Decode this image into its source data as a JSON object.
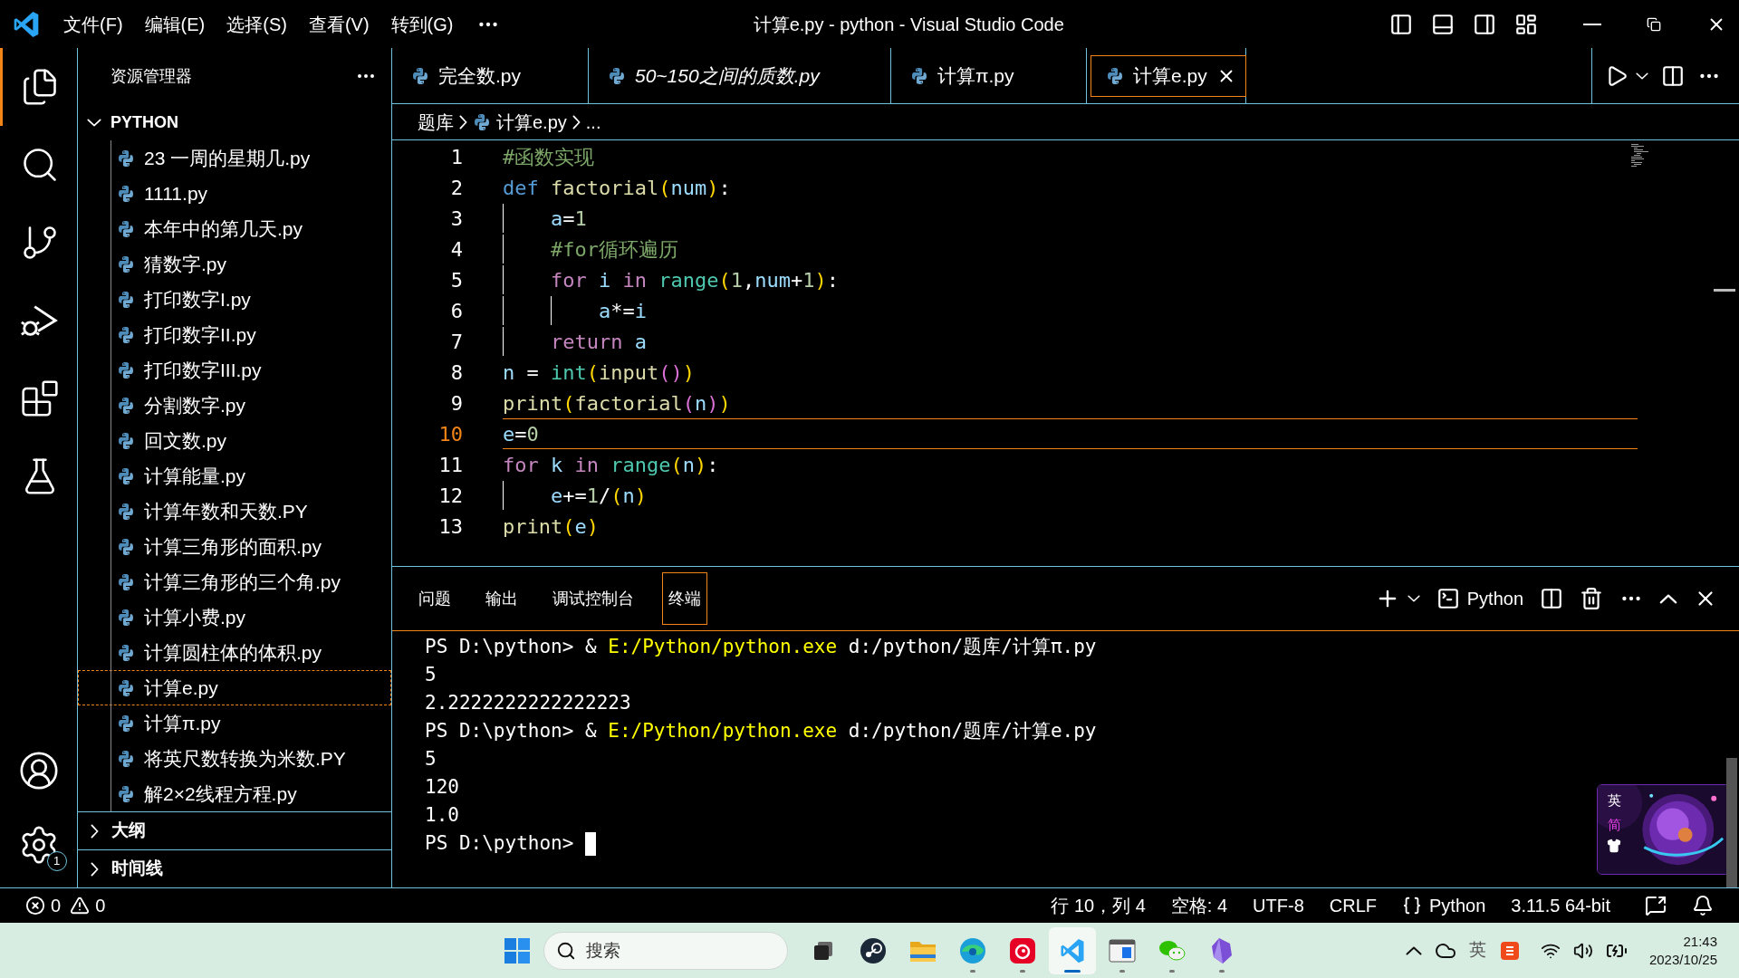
{
  "title_bar": {
    "menus": [
      "文件(F)",
      "编辑(E)",
      "选择(S)",
      "查看(V)",
      "转到(G)"
    ],
    "title": "计算e.py - python - Visual Studio Code"
  },
  "activity_bar": {
    "items": [
      {
        "kind": "explorer",
        "selected": true
      },
      {
        "kind": "search",
        "selected": false
      },
      {
        "kind": "source-control",
        "selected": false
      },
      {
        "kind": "run-debug",
        "selected": false
      },
      {
        "kind": "extensions",
        "selected": false
      },
      {
        "kind": "testing",
        "selected": false
      }
    ],
    "settings_badge": "1"
  },
  "sidebar": {
    "title": "资源管理器",
    "folder": {
      "label": "PYTHON",
      "expanded": true,
      "files": [
        {
          "label": "23 一周的星期几.py",
          "selected": false
        },
        {
          "label": "1111.py",
          "selected": false
        },
        {
          "label": "本年中的第几天.py",
          "selected": false
        },
        {
          "label": "猜数字.py",
          "selected": false
        },
        {
          "label": "打印数字I.py",
          "selected": false
        },
        {
          "label": "打印数字II.py",
          "selected": false
        },
        {
          "label": "打印数字III.py",
          "selected": false
        },
        {
          "label": "分割数字.py",
          "selected": false
        },
        {
          "label": "回文数.py",
          "selected": false
        },
        {
          "label": "计算能量.py",
          "selected": false
        },
        {
          "label": "计算年数和天数.PY",
          "selected": false
        },
        {
          "label": "计算三角形的面积.py",
          "selected": false
        },
        {
          "label": "计算三角形的三个角.py",
          "selected": false
        },
        {
          "label": "计算小费.py",
          "selected": false
        },
        {
          "label": "计算圆柱体的体积.py",
          "selected": false
        },
        {
          "label": "计算e.py",
          "selected": true
        },
        {
          "label": "计算π.py",
          "selected": false
        },
        {
          "label": "将英尺数转换为米数.PY",
          "selected": false
        },
        {
          "label": "解2×2线程方程.py",
          "selected": false
        }
      ]
    },
    "sections": [
      {
        "label": "大纲",
        "expanded": false
      },
      {
        "label": "时间线",
        "expanded": false
      }
    ]
  },
  "tabs": [
    {
      "label": "完全数.py",
      "selected": false,
      "preview": false
    },
    {
      "label": "50~150之间的质数.py",
      "selected": false,
      "preview": true
    },
    {
      "label": "计算π.py",
      "selected": false,
      "preview": false
    },
    {
      "label": "计算e.py",
      "selected": true,
      "preview": false
    }
  ],
  "breadcrumb": [
    "题库",
    "计算e.py",
    "..."
  ],
  "editor": {
    "lines": [
      {
        "number": "1",
        "current": false,
        "tokens": [
          {
            "kind": "comment",
            "text": "#函数实现"
          }
        ]
      },
      {
        "number": "2",
        "current": false,
        "tokens": [
          {
            "kind": "keyword",
            "text": "def"
          },
          {
            "kind": "function",
            "text": " factorial"
          },
          {
            "kind": "bracket1",
            "text": "("
          },
          {
            "kind": "variable",
            "text": "num"
          },
          {
            "kind": "bracket1",
            "text": ")"
          },
          {
            "kind": "plain",
            "text": ":"
          }
        ]
      },
      {
        "number": "3",
        "current": false,
        "tokens": [
          {
            "kind": "guide"
          },
          {
            "kind": "variable",
            "text": "a"
          },
          {
            "kind": "plain",
            "text": "="
          },
          {
            "kind": "number",
            "text": "1"
          }
        ]
      },
      {
        "number": "4",
        "current": false,
        "tokens": [
          {
            "kind": "guide"
          },
          {
            "kind": "comment",
            "text": "#for循环遍历"
          }
        ]
      },
      {
        "number": "5",
        "current": false,
        "tokens": [
          {
            "kind": "guide"
          },
          {
            "kind": "control",
            "text": "for"
          },
          {
            "kind": "variable",
            "text": " i"
          },
          {
            "kind": "control",
            "text": " in"
          },
          {
            "kind": "builtin",
            "text": " range"
          },
          {
            "kind": "bracket1",
            "text": "("
          },
          {
            "kind": "number",
            "text": "1"
          },
          {
            "kind": "plain",
            "text": ","
          },
          {
            "kind": "variable",
            "text": "num"
          },
          {
            "kind": "plain",
            "text": "+"
          },
          {
            "kind": "number",
            "text": "1"
          },
          {
            "kind": "bracket1",
            "text": ")"
          },
          {
            "kind": "plain",
            "text": ":"
          }
        ]
      },
      {
        "number": "6",
        "current": false,
        "tokens": [
          {
            "kind": "guide"
          },
          {
            "kind": "guide"
          },
          {
            "kind": "variable",
            "text": "a"
          },
          {
            "kind": "plain",
            "text": "*="
          },
          {
            "kind": "variable",
            "text": "i"
          }
        ]
      },
      {
        "number": "7",
        "current": false,
        "tokens": [
          {
            "kind": "guide"
          },
          {
            "kind": "control",
            "text": "return"
          },
          {
            "kind": "variable",
            "text": " a"
          }
        ]
      },
      {
        "number": "8",
        "current": false,
        "tokens": [
          {
            "kind": "variable",
            "text": "n"
          },
          {
            "kind": "plain",
            "text": " = "
          },
          {
            "kind": "builtin",
            "text": "int"
          },
          {
            "kind": "bracket1",
            "text": "("
          },
          {
            "kind": "function",
            "text": "input"
          },
          {
            "kind": "bracket2",
            "text": "()"
          },
          {
            "kind": "bracket1",
            "text": ")"
          }
        ]
      },
      {
        "number": "9",
        "current": false,
        "tokens": [
          {
            "kind": "function",
            "text": "print"
          },
          {
            "kind": "bracket1",
            "text": "("
          },
          {
            "kind": "function",
            "text": "factorial"
          },
          {
            "kind": "bracket2",
            "text": "("
          },
          {
            "kind": "variable",
            "text": "n"
          },
          {
            "kind": "bracket2",
            "text": ")"
          },
          {
            "kind": "bracket1",
            "text": ")"
          }
        ]
      },
      {
        "number": "10",
        "current": true,
        "tokens": [
          {
            "kind": "variable",
            "text": "e"
          },
          {
            "kind": "plain",
            "text": "="
          },
          {
            "kind": "number",
            "text": "0"
          }
        ]
      },
      {
        "number": "11",
        "current": false,
        "tokens": [
          {
            "kind": "control",
            "text": "for"
          },
          {
            "kind": "variable",
            "text": " k"
          },
          {
            "kind": "control",
            "text": " in"
          },
          {
            "kind": "builtin",
            "text": " range"
          },
          {
            "kind": "bracket1",
            "text": "("
          },
          {
            "kind": "variable",
            "text": "n"
          },
          {
            "kind": "bracket1",
            "text": ")"
          },
          {
            "kind": "plain",
            "text": ":"
          }
        ]
      },
      {
        "number": "12",
        "current": false,
        "tokens": [
          {
            "kind": "guide"
          },
          {
            "kind": "variable",
            "text": "e"
          },
          {
            "kind": "plain",
            "text": "+="
          },
          {
            "kind": "number",
            "text": "1"
          },
          {
            "kind": "plain",
            "text": "/"
          },
          {
            "kind": "bracket1",
            "text": "("
          },
          {
            "kind": "variable",
            "text": "n"
          },
          {
            "kind": "bracket1",
            "text": ")"
          }
        ]
      },
      {
        "number": "13",
        "current": false,
        "tokens": [
          {
            "kind": "function",
            "text": "print"
          },
          {
            "kind": "bracket1",
            "text": "("
          },
          {
            "kind": "variable",
            "text": "e"
          },
          {
            "kind": "bracket1",
            "text": ")"
          }
        ]
      }
    ]
  },
  "panel": {
    "tabs": [
      {
        "label": "问题",
        "selected": false
      },
      {
        "label": "输出",
        "selected": false
      },
      {
        "label": "调试控制台",
        "selected": false
      },
      {
        "label": "终端",
        "selected": true
      }
    ],
    "terminal_profile": "Python",
    "terminal_lines": [
      {
        "cursor": false,
        "parts": [
          {
            "kind": "plain",
            "text": "PS D:\\python> & "
          },
          {
            "kind": "path",
            "text": "E:/Python/python.exe"
          },
          {
            "kind": "plain",
            "text": " d:/python/题库/计算π.py"
          }
        ]
      },
      {
        "cursor": false,
        "parts": [
          {
            "kind": "plain",
            "text": "5"
          }
        ]
      },
      {
        "cursor": false,
        "parts": [
          {
            "kind": "plain",
            "text": "2.2222222222222223"
          }
        ]
      },
      {
        "cursor": false,
        "parts": [
          {
            "kind": "plain",
            "text": "PS D:\\python> & "
          },
          {
            "kind": "path",
            "text": "E:/Python/python.exe"
          },
          {
            "kind": "plain",
            "text": " d:/python/题库/计算e.py"
          }
        ]
      },
      {
        "cursor": false,
        "parts": [
          {
            "kind": "plain",
            "text": "5"
          }
        ]
      },
      {
        "cursor": false,
        "parts": [
          {
            "kind": "plain",
            "text": "120"
          }
        ]
      },
      {
        "cursor": false,
        "parts": [
          {
            "kind": "plain",
            "text": "1.0"
          }
        ]
      },
      {
        "cursor": true,
        "parts": [
          {
            "kind": "plain",
            "text": "PS D:\\python> "
          }
        ]
      }
    ],
    "ime_widget": {
      "mode": "英",
      "script": "简"
    }
  },
  "status_bar": {
    "errors": "0",
    "warnings": "0",
    "items": [
      "行 10，列 4",
      "空格: 4",
      "UTF-8",
      "CRLF"
    ],
    "language": "Python",
    "interpreter": "3.11.5 64-bit"
  },
  "taskbar": {
    "search_placeholder": "搜索",
    "apps": [
      {
        "kind": "task-view",
        "selected": false,
        "running": false
      },
      {
        "kind": "steam",
        "selected": false,
        "running": false
      },
      {
        "kind": "folder",
        "selected": false,
        "running": false
      },
      {
        "kind": "edge",
        "selected": false,
        "running": true
      },
      {
        "kind": "netease",
        "selected": false,
        "running": true
      },
      {
        "kind": "vscode",
        "selected": true,
        "running": true
      },
      {
        "kind": "window",
        "selected": false,
        "running": true
      },
      {
        "kind": "wechat",
        "selected": false,
        "running": true
      },
      {
        "kind": "obsidian",
        "selected": false,
        "running": true
      }
    ],
    "ime": "英",
    "time": "21:43",
    "date": "2023/10/25"
  }
}
